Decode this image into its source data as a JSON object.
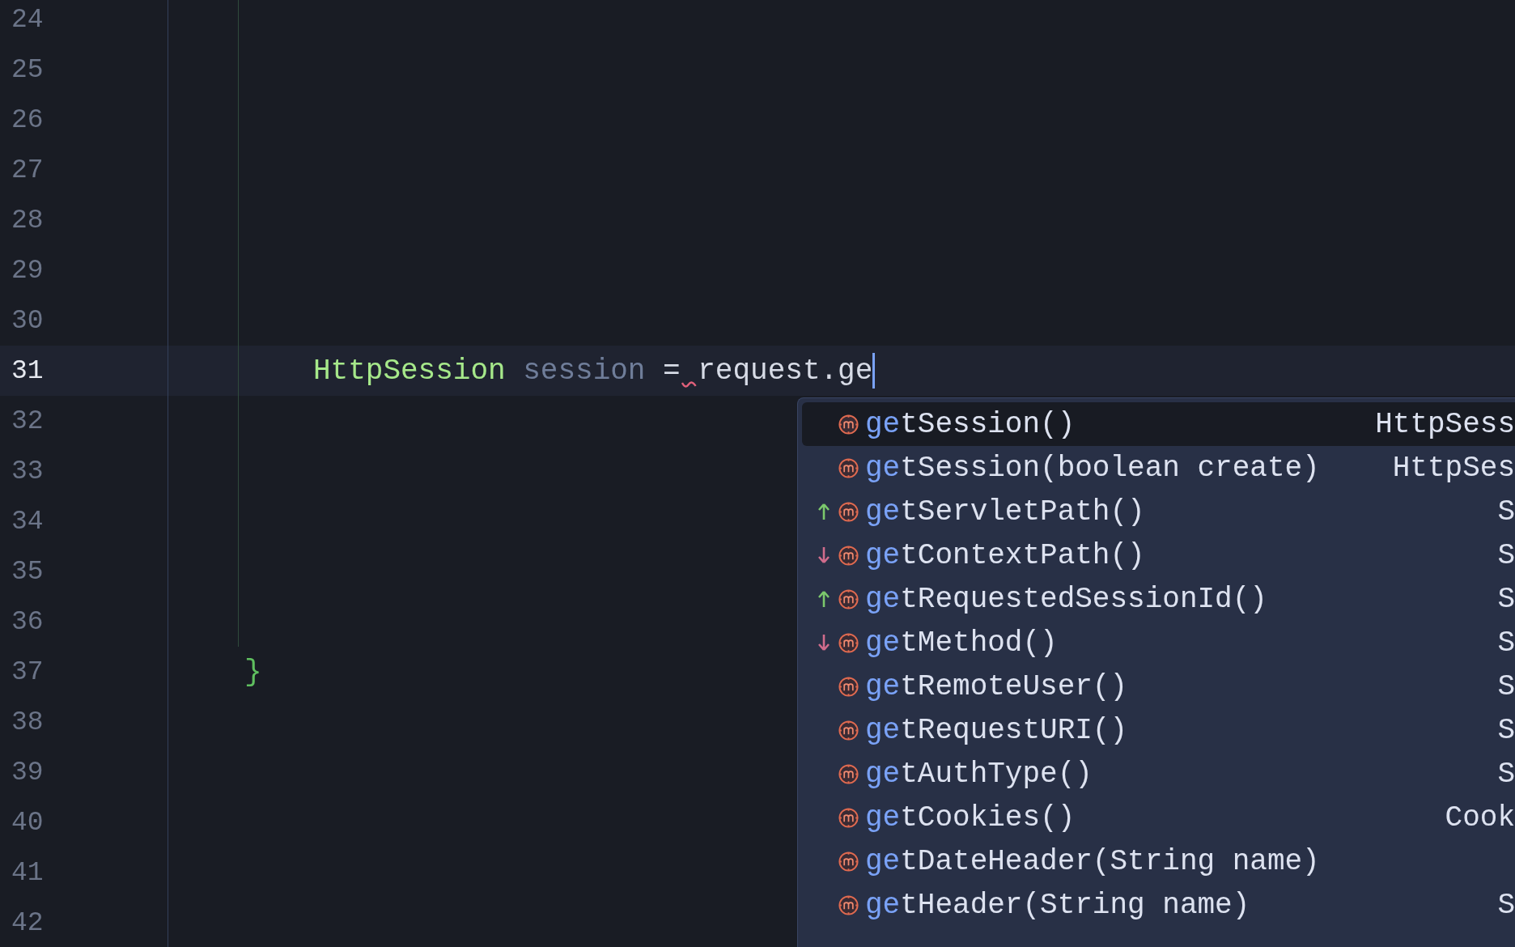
{
  "editor": {
    "lines": [
      {
        "number": "24",
        "current": false
      },
      {
        "number": "25",
        "current": false
      },
      {
        "number": "26",
        "current": false
      },
      {
        "number": "27",
        "current": false
      },
      {
        "number": "28",
        "current": false
      },
      {
        "number": "29",
        "current": false
      },
      {
        "number": "30",
        "current": false
      },
      {
        "number": "31",
        "current": true,
        "tokens": [
          {
            "kind": "indent"
          },
          {
            "kind": "type",
            "text": "HttpSession"
          },
          {
            "kind": "space"
          },
          {
            "kind": "variable",
            "text": "session"
          },
          {
            "kind": "space"
          },
          {
            "kind": "plain",
            "text": "="
          },
          {
            "kind": "squiggle"
          },
          {
            "kind": "plain",
            "text": "request.ge"
          },
          {
            "kind": "caret"
          }
        ]
      },
      {
        "number": "32",
        "current": false
      },
      {
        "number": "33",
        "current": false
      },
      {
        "number": "34",
        "current": false
      },
      {
        "number": "35",
        "current": false
      },
      {
        "number": "36",
        "current": false
      },
      {
        "number": "37",
        "current": false,
        "tokens": [
          {
            "kind": "brace",
            "text": "}"
          }
        ]
      },
      {
        "number": "38",
        "current": false
      },
      {
        "number": "39",
        "current": false
      },
      {
        "number": "40",
        "current": false
      },
      {
        "number": "41",
        "current": false
      },
      {
        "number": "42",
        "current": false
      }
    ]
  },
  "completion": {
    "items": [
      {
        "match": "ge",
        "rest": "tSession()",
        "type": "HttpSess",
        "selected": true
      },
      {
        "match": "ge",
        "rest": "tSession(boolean create)",
        "type": "HttpSes",
        "selected": false
      },
      {
        "kind": "up",
        "match": "ge",
        "rest": "tServletPath()",
        "type": "S",
        "selected": false
      },
      {
        "kind": "down",
        "match": "ge",
        "rest": "tContextPath()",
        "type": "S",
        "selected": false
      },
      {
        "kind": "up",
        "match": "ge",
        "rest": "tRequestedSessionId()",
        "type": "S",
        "selected": false
      },
      {
        "kind": "down",
        "match": "ge",
        "rest": "tMethod()",
        "type": "S",
        "selected": false
      },
      {
        "match": "ge",
        "rest": "tRemoteUser()",
        "type": "S",
        "selected": false
      },
      {
        "match": "ge",
        "rest": "tRequestURI()",
        "type": "S",
        "selected": false
      },
      {
        "match": "ge",
        "rest": "tAuthType()",
        "type": "S",
        "selected": false
      },
      {
        "match": "ge",
        "rest": "tCookies()",
        "type": "Cook",
        "selected": false
      },
      {
        "match": "ge",
        "rest": "tDateHeader(String name)",
        "selected": false
      },
      {
        "match": "ge",
        "rest": "tHeader(String name)",
        "type": "S",
        "selected": false
      }
    ]
  }
}
